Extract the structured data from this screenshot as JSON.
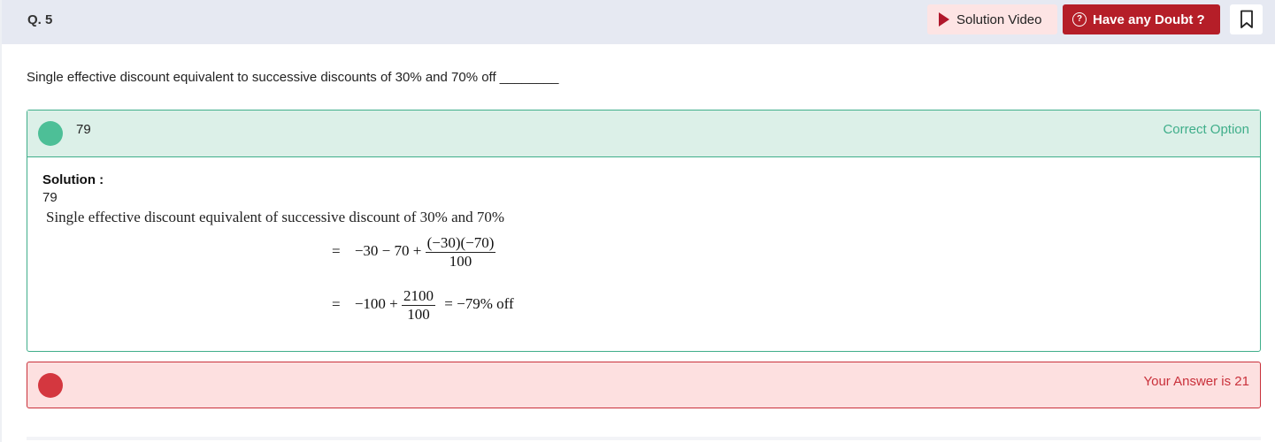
{
  "header": {
    "question_number": "Q. 5",
    "solution_video_label": "Solution Video",
    "doubt_label": "Have any Doubt ?",
    "bookmark_icon": "bookmark-icon"
  },
  "question": {
    "text": "Single effective discount equivalent to successive discounts of 30% and 70% off ________"
  },
  "correct_option": {
    "value": "79",
    "tag": "Correct Option",
    "solution_label": "Solution :",
    "solution_value": "79",
    "solution_text": "Single effective discount equivalent of successive discount of 30% and 70%",
    "step1_eq": "=",
    "step1_lhs": "−30 − 70 +",
    "step1_num": "(−30)(−70)",
    "step1_den": "100",
    "step2_eq": "=",
    "step2_lhs": "−100 +",
    "step2_num": "2100",
    "step2_den": "100",
    "step2_rhs": "= −79% off"
  },
  "wrong_option": {
    "text": "Your Answer is 21"
  },
  "colors": {
    "header_bg": "#e6e9f2",
    "brand_red": "#b51e28",
    "correct_green": "#3fae8a",
    "correct_bg": "#dcf0e8",
    "wrong_red": "#c9303a",
    "wrong_bg": "#fde0e0"
  }
}
